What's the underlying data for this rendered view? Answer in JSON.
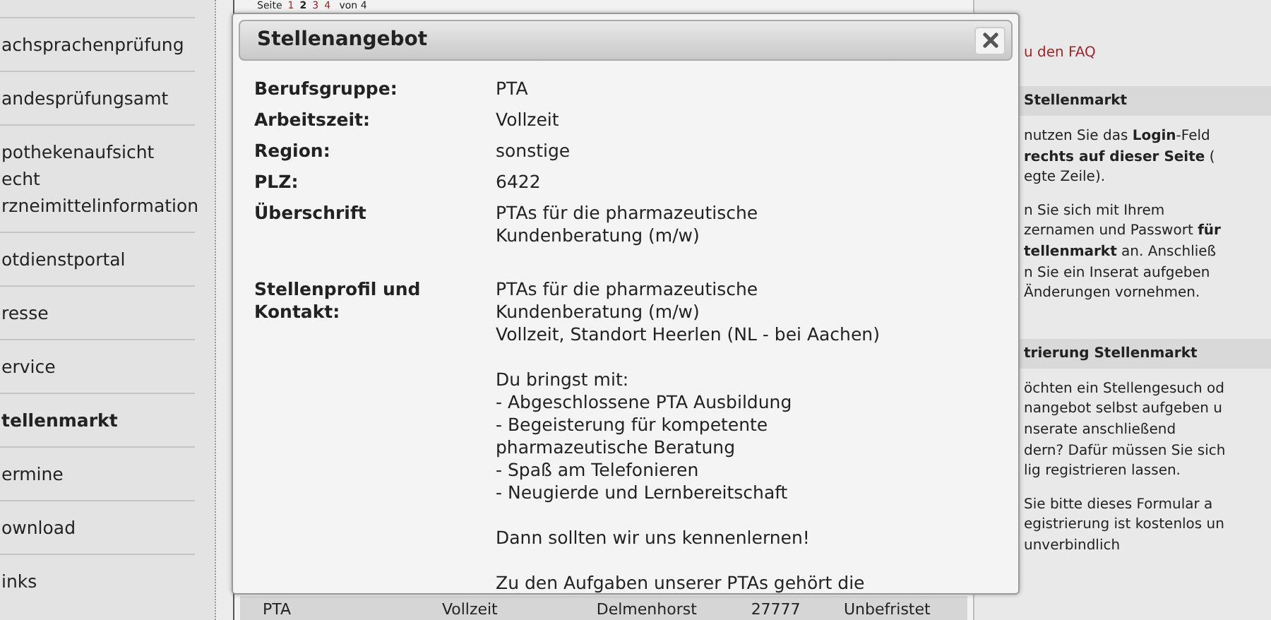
{
  "sidebar": {
    "items": [
      {
        "links": [
          "achsprachenprüfung"
        ],
        "selected": false
      },
      {
        "links": [
          "andesprüfungsamt"
        ],
        "selected": false
      },
      {
        "links": [
          "pothekenaufsicht",
          "echt",
          "rzneimittelinformation"
        ],
        "selected": false
      },
      {
        "links": [
          "otdienstportal"
        ],
        "selected": false
      },
      {
        "links": [
          "resse"
        ],
        "selected": false
      },
      {
        "links": [
          "ervice"
        ],
        "selected": false
      },
      {
        "links": [
          "tellenmarkt"
        ],
        "selected": true
      },
      {
        "links": [
          "ermine"
        ],
        "selected": false
      },
      {
        "links": [
          "ownload"
        ],
        "selected": false
      },
      {
        "links": [
          "inks"
        ],
        "selected": false
      }
    ]
  },
  "pagination": {
    "label": "Seite",
    "pages": [
      {
        "label": "1",
        "selected": false
      },
      {
        "label": "2",
        "selected": true
      },
      {
        "label": "3",
        "selected": false
      },
      {
        "label": "4",
        "selected": false
      }
    ],
    "total": "von 4"
  },
  "table": {
    "rows": [
      [
        "PTA",
        "Vollzeit",
        "Delmenhorst",
        "27777",
        "Unbefristet"
      ]
    ]
  },
  "right_column": {
    "blocks": [
      {
        "kind": "link",
        "text": "u den FAQ"
      },
      {
        "kind": "heading",
        "text": "Stellenmarkt"
      },
      {
        "kind": "paragraph",
        "lines": [
          "nutzen Sie das **Login**-Feld",
          "**rechts auf dieser Seite** (",
          "egte Zeile)."
        ]
      },
      {
        "kind": "paragraph",
        "lines": [
          "n Sie sich mit Ihrem",
          "zernamen und Passwort **für**",
          "**tellenmarkt** an. Anschließ",
          "n Sie ein Inserat aufgeben",
          "Änderungen vornehmen."
        ]
      },
      {
        "kind": "heading",
        "text": "trierung Stellenmarkt"
      },
      {
        "kind": "paragraph",
        "lines": [
          "öchten ein Stellengesuch od",
          "nangebot selbst aufgeben u",
          "nserate anschließend",
          "dern? Dafür müssen Sie sich",
          "lig registrieren lassen."
        ]
      },
      {
        "kind": "paragraph",
        "lines": [
          "Sie bitte dieses Formular a",
          "egistrierung ist kostenlos un",
          "unverbindlich"
        ]
      }
    ]
  },
  "dialog": {
    "title": "Stellenangebot",
    "fields": [
      {
        "label": "Berufsgruppe:",
        "paragraphs": [
          [
            "PTA"
          ]
        ]
      },
      {
        "label": "Arbeitszeit:",
        "paragraphs": [
          [
            "Vollzeit"
          ]
        ]
      },
      {
        "label": "Region:",
        "paragraphs": [
          [
            "sonstige"
          ]
        ]
      },
      {
        "label": "PLZ:",
        "paragraphs": [
          [
            "6422"
          ]
        ]
      },
      {
        "label": "Überschrift",
        "paragraphs": [
          [
            "PTAs für die pharmazeutische",
            "Kundenberatung (m/w)"
          ]
        ]
      },
      {
        "label": "Stellenprofil und Kontakt:",
        "paragraphs": [
          [
            "PTAs für die pharmazeutische",
            "Kundenberatung (m/w)",
            "Vollzeit, Standort Heerlen (NL - bei Aachen)"
          ],
          [
            "Du bringst mit:",
            "- Abgeschlossene PTA Ausbildung",
            "- Begeisterung für kompetente",
            "pharmazeutische Beratung",
            "- Spaß am Telefonieren",
            "- Neugierde und Lernbereitschaft"
          ],
          [
            "Dann sollten wir uns kennenlernen!"
          ],
          [
            "Zu den Aufgaben unserer PTAs gehört die"
          ]
        ]
      }
    ]
  }
}
